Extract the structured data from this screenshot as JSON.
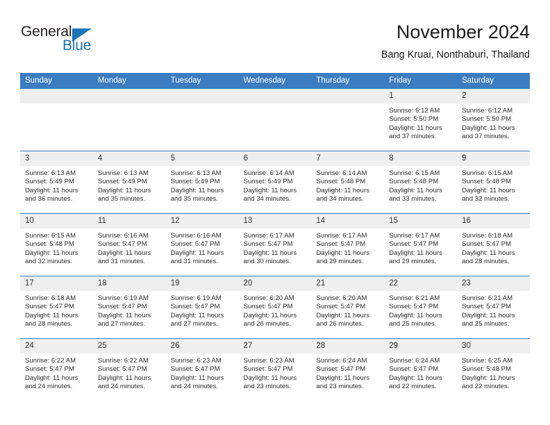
{
  "logo": {
    "word_top": "General",
    "word_bottom": "Blue",
    "triangle_color": "#1b75bb"
  },
  "header": {
    "title": "November 2024",
    "subtitle": "Bang Kruai, Nonthaburi, Thailand"
  },
  "colors": {
    "header_blue": "#3c7cc0",
    "daynum_band": "#efeff0",
    "logo_blue": "#1b75bb",
    "text": "#2b2b2b"
  },
  "weekdays": [
    "Sunday",
    "Monday",
    "Tuesday",
    "Wednesday",
    "Thursday",
    "Friday",
    "Saturday"
  ],
  "weeks": [
    [
      {
        "day": "",
        "empty": true
      },
      {
        "day": "",
        "empty": true
      },
      {
        "day": "",
        "empty": true
      },
      {
        "day": "",
        "empty": true
      },
      {
        "day": "",
        "empty": true
      },
      {
        "day": "1",
        "sunrise": "Sunrise: 6:12 AM",
        "sunset": "Sunset: 5:50 PM",
        "daylight": "Daylight: 11 hours and 37 minutes."
      },
      {
        "day": "2",
        "sunrise": "Sunrise: 6:12 AM",
        "sunset": "Sunset: 5:50 PM",
        "daylight": "Daylight: 11 hours and 37 minutes."
      }
    ],
    [
      {
        "day": "3",
        "sunrise": "Sunrise: 6:13 AM",
        "sunset": "Sunset: 5:49 PM",
        "daylight": "Daylight: 11 hours and 36 minutes."
      },
      {
        "day": "4",
        "sunrise": "Sunrise: 6:13 AM",
        "sunset": "Sunset: 5:49 PM",
        "daylight": "Daylight: 11 hours and 35 minutes."
      },
      {
        "day": "5",
        "sunrise": "Sunrise: 6:13 AM",
        "sunset": "Sunset: 5:49 PM",
        "daylight": "Daylight: 11 hours and 35 minutes."
      },
      {
        "day": "6",
        "sunrise": "Sunrise: 6:14 AM",
        "sunset": "Sunset: 5:49 PM",
        "daylight": "Daylight: 11 hours and 34 minutes."
      },
      {
        "day": "7",
        "sunrise": "Sunrise: 6:14 AM",
        "sunset": "Sunset: 5:48 PM",
        "daylight": "Daylight: 11 hours and 34 minutes."
      },
      {
        "day": "8",
        "sunrise": "Sunrise: 6:15 AM",
        "sunset": "Sunset: 5:48 PM",
        "daylight": "Daylight: 11 hours and 33 minutes."
      },
      {
        "day": "9",
        "sunrise": "Sunrise: 6:15 AM",
        "sunset": "Sunset: 5:48 PM",
        "daylight": "Daylight: 11 hours and 32 minutes."
      }
    ],
    [
      {
        "day": "10",
        "sunrise": "Sunrise: 6:15 AM",
        "sunset": "Sunset: 5:48 PM",
        "daylight": "Daylight: 11 hours and 32 minutes."
      },
      {
        "day": "11",
        "sunrise": "Sunrise: 6:16 AM",
        "sunset": "Sunset: 5:47 PM",
        "daylight": "Daylight: 11 hours and 31 minutes."
      },
      {
        "day": "12",
        "sunrise": "Sunrise: 6:16 AM",
        "sunset": "Sunset: 5:47 PM",
        "daylight": "Daylight: 11 hours and 31 minutes."
      },
      {
        "day": "13",
        "sunrise": "Sunrise: 6:17 AM",
        "sunset": "Sunset: 5:47 PM",
        "daylight": "Daylight: 11 hours and 30 minutes."
      },
      {
        "day": "14",
        "sunrise": "Sunrise: 6:17 AM",
        "sunset": "Sunset: 5:47 PM",
        "daylight": "Daylight: 11 hours and 29 minutes."
      },
      {
        "day": "15",
        "sunrise": "Sunrise: 6:17 AM",
        "sunset": "Sunset: 5:47 PM",
        "daylight": "Daylight: 11 hours and 29 minutes."
      },
      {
        "day": "16",
        "sunrise": "Sunrise: 6:18 AM",
        "sunset": "Sunset: 5:47 PM",
        "daylight": "Daylight: 11 hours and 28 minutes."
      }
    ],
    [
      {
        "day": "17",
        "sunrise": "Sunrise: 6:18 AM",
        "sunset": "Sunset: 5:47 PM",
        "daylight": "Daylight: 11 hours and 28 minutes."
      },
      {
        "day": "18",
        "sunrise": "Sunrise: 6:19 AM",
        "sunset": "Sunset: 5:47 PM",
        "daylight": "Daylight: 11 hours and 27 minutes."
      },
      {
        "day": "19",
        "sunrise": "Sunrise: 6:19 AM",
        "sunset": "Sunset: 5:47 PM",
        "daylight": "Daylight: 11 hours and 27 minutes."
      },
      {
        "day": "20",
        "sunrise": "Sunrise: 6:20 AM",
        "sunset": "Sunset: 5:47 PM",
        "daylight": "Daylight: 11 hours and 26 minutes."
      },
      {
        "day": "21",
        "sunrise": "Sunrise: 6:20 AM",
        "sunset": "Sunset: 5:47 PM",
        "daylight": "Daylight: 11 hours and 26 minutes."
      },
      {
        "day": "22",
        "sunrise": "Sunrise: 6:21 AM",
        "sunset": "Sunset: 5:47 PM",
        "daylight": "Daylight: 11 hours and 25 minutes."
      },
      {
        "day": "23",
        "sunrise": "Sunrise: 6:21 AM",
        "sunset": "Sunset: 5:47 PM",
        "daylight": "Daylight: 11 hours and 25 minutes."
      }
    ],
    [
      {
        "day": "24",
        "sunrise": "Sunrise: 6:22 AM",
        "sunset": "Sunset: 5:47 PM",
        "daylight": "Daylight: 11 hours and 24 minutes."
      },
      {
        "day": "25",
        "sunrise": "Sunrise: 6:22 AM",
        "sunset": "Sunset: 5:47 PM",
        "daylight": "Daylight: 11 hours and 24 minutes."
      },
      {
        "day": "26",
        "sunrise": "Sunrise: 6:23 AM",
        "sunset": "Sunset: 5:47 PM",
        "daylight": "Daylight: 11 hours and 24 minutes."
      },
      {
        "day": "27",
        "sunrise": "Sunrise: 6:23 AM",
        "sunset": "Sunset: 5:47 PM",
        "daylight": "Daylight: 11 hours and 23 minutes."
      },
      {
        "day": "28",
        "sunrise": "Sunrise: 6:24 AM",
        "sunset": "Sunset: 5:47 PM",
        "daylight": "Daylight: 11 hours and 23 minutes."
      },
      {
        "day": "29",
        "sunrise": "Sunrise: 6:24 AM",
        "sunset": "Sunset: 5:47 PM",
        "daylight": "Daylight: 11 hours and 22 minutes."
      },
      {
        "day": "30",
        "sunrise": "Sunrise: 6:25 AM",
        "sunset": "Sunset: 5:48 PM",
        "daylight": "Daylight: 11 hours and 22 minutes."
      }
    ]
  ]
}
